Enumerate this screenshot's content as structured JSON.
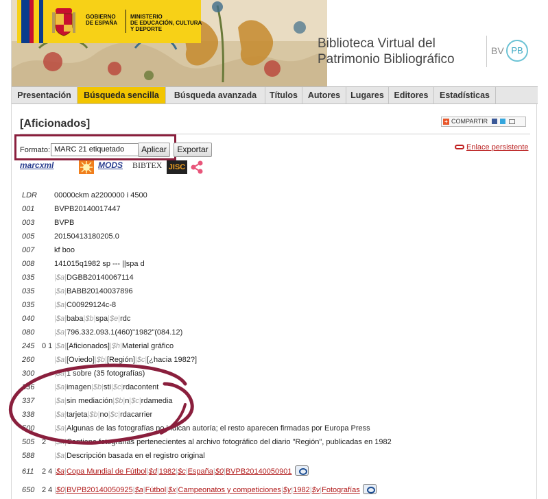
{
  "header": {
    "gov_line1": "GOBIERNO",
    "gov_line2": "DE ESPAÑA",
    "ministry_line1": "MINISTERIO",
    "ministry_line2": "DE EDUCACIÓN, CULTURA",
    "ministry_line3": "Y DEPORTE",
    "site_title_line1": "Biblioteca Virtual del",
    "site_title_line2": "Patrimonio Bibliográfico",
    "logo_bv": "BV",
    "logo_pb": "PB"
  },
  "nav": {
    "items": [
      {
        "label": "Presentación"
      },
      {
        "label": "Búsqueda sencilla"
      },
      {
        "label": "Búsqueda avanzada"
      },
      {
        "label": "Títulos"
      },
      {
        "label": "Autores"
      },
      {
        "label": "Lugares"
      },
      {
        "label": "Editores"
      },
      {
        "label": "Estadísticas"
      }
    ],
    "active_index": 1,
    "active_color": "#f2c500"
  },
  "record": {
    "title": "[Aficionados]",
    "share_label": "COMPARTIR",
    "format_label": "Formato:",
    "format_selected": "MARC 21 etiquetado",
    "apply_label": "Aplicar",
    "export_label": "Exportar",
    "permalink_label": "Enlace persistente",
    "format_icons": [
      "marcxml",
      "rdf-icon",
      "mods",
      "bibtex",
      "jisc",
      "share-graph-icon"
    ],
    "format_icon_labels": {
      "marcxml": "marcxml",
      "mods": "MODS",
      "bibtex": "BIBTEX",
      "jisc": "JISC"
    }
  },
  "marc": {
    "ldr": {
      "tag": "LDR",
      "value": "00000ckm a2200000 i 4500"
    },
    "f001": {
      "tag": "001",
      "value": "BVPB20140017447"
    },
    "f003": {
      "tag": "003",
      "value": "BVPB"
    },
    "f005": {
      "tag": "005",
      "value": "20150413180205.0"
    },
    "f007": {
      "tag": "007",
      "value": "kf boo"
    },
    "f008": {
      "tag": "008",
      "value": "141015q1982 sp --- ||spa d"
    },
    "f035a": {
      "tag": "035",
      "a": "DGBB20140067114"
    },
    "f035b": {
      "tag": "035",
      "a": "BABB20140037896"
    },
    "f035c": {
      "tag": "035",
      "a": "C00929124c-8"
    },
    "f040": {
      "tag": "040",
      "a": "baba",
      "b": "spa",
      "e": "rdc"
    },
    "f080": {
      "tag": "080",
      "a": "796.332.093.1(460)\"1982\"(084.12)"
    },
    "f245": {
      "tag": "245",
      "ind": "0 1",
      "a": "[Aficionados]",
      "h": "Material gráfico"
    },
    "f260": {
      "tag": "260",
      "a": "[Oviedo]",
      "b": "[Región]",
      "c": "[¿hacia 1982?]"
    },
    "f300": {
      "tag": "300",
      "a": "1 sobre (35 fotografías)"
    },
    "f336": {
      "tag": "336",
      "a": "imagen",
      "b": "sti",
      "c": "rdacontent"
    },
    "f337": {
      "tag": "337",
      "a": "sin mediación",
      "b": "n",
      "c": "rdamedia"
    },
    "f338": {
      "tag": "338",
      "a": "tarjeta",
      "b": "no",
      "c": "rdacarrier"
    },
    "f500": {
      "tag": "500",
      "a": "Algunas de las fotografías no indican autoría; el resto aparecen firmadas por Europa Press"
    },
    "f505": {
      "tag": "505",
      "ind": "2",
      "a": "Contiene fotografías pertenecientes al archivo fotográfico del diario \"Región\", publicadas en 1982"
    },
    "f588": {
      "tag": "588",
      "a": "Descripción basada en el registro original"
    },
    "f611": {
      "tag": "611",
      "ind": "2 4",
      "a": "Copa Mundial de Fútbol",
      "d": "1982",
      "c": "España",
      "0": "BVPB20140050901"
    },
    "f650": {
      "tag": "650",
      "ind": "2 4",
      "0": "BVPB20140050925",
      "a": "Fútbol",
      "x": "Campeonatos y competiciones",
      "y": "1982",
      "v": "Fotografías"
    },
    "sub_labels": {
      "a": "$a",
      "b": "$b",
      "c": "$c",
      "d": "$d",
      "e": "$e",
      "h": "$h",
      "x": "$x",
      "y": "$y",
      "v": "$v",
      "z": "$0"
    }
  },
  "colors": {
    "annotation_ellipse": "#8a1f3d",
    "link": "#b01818",
    "gov_yellow": "#f7d117"
  }
}
